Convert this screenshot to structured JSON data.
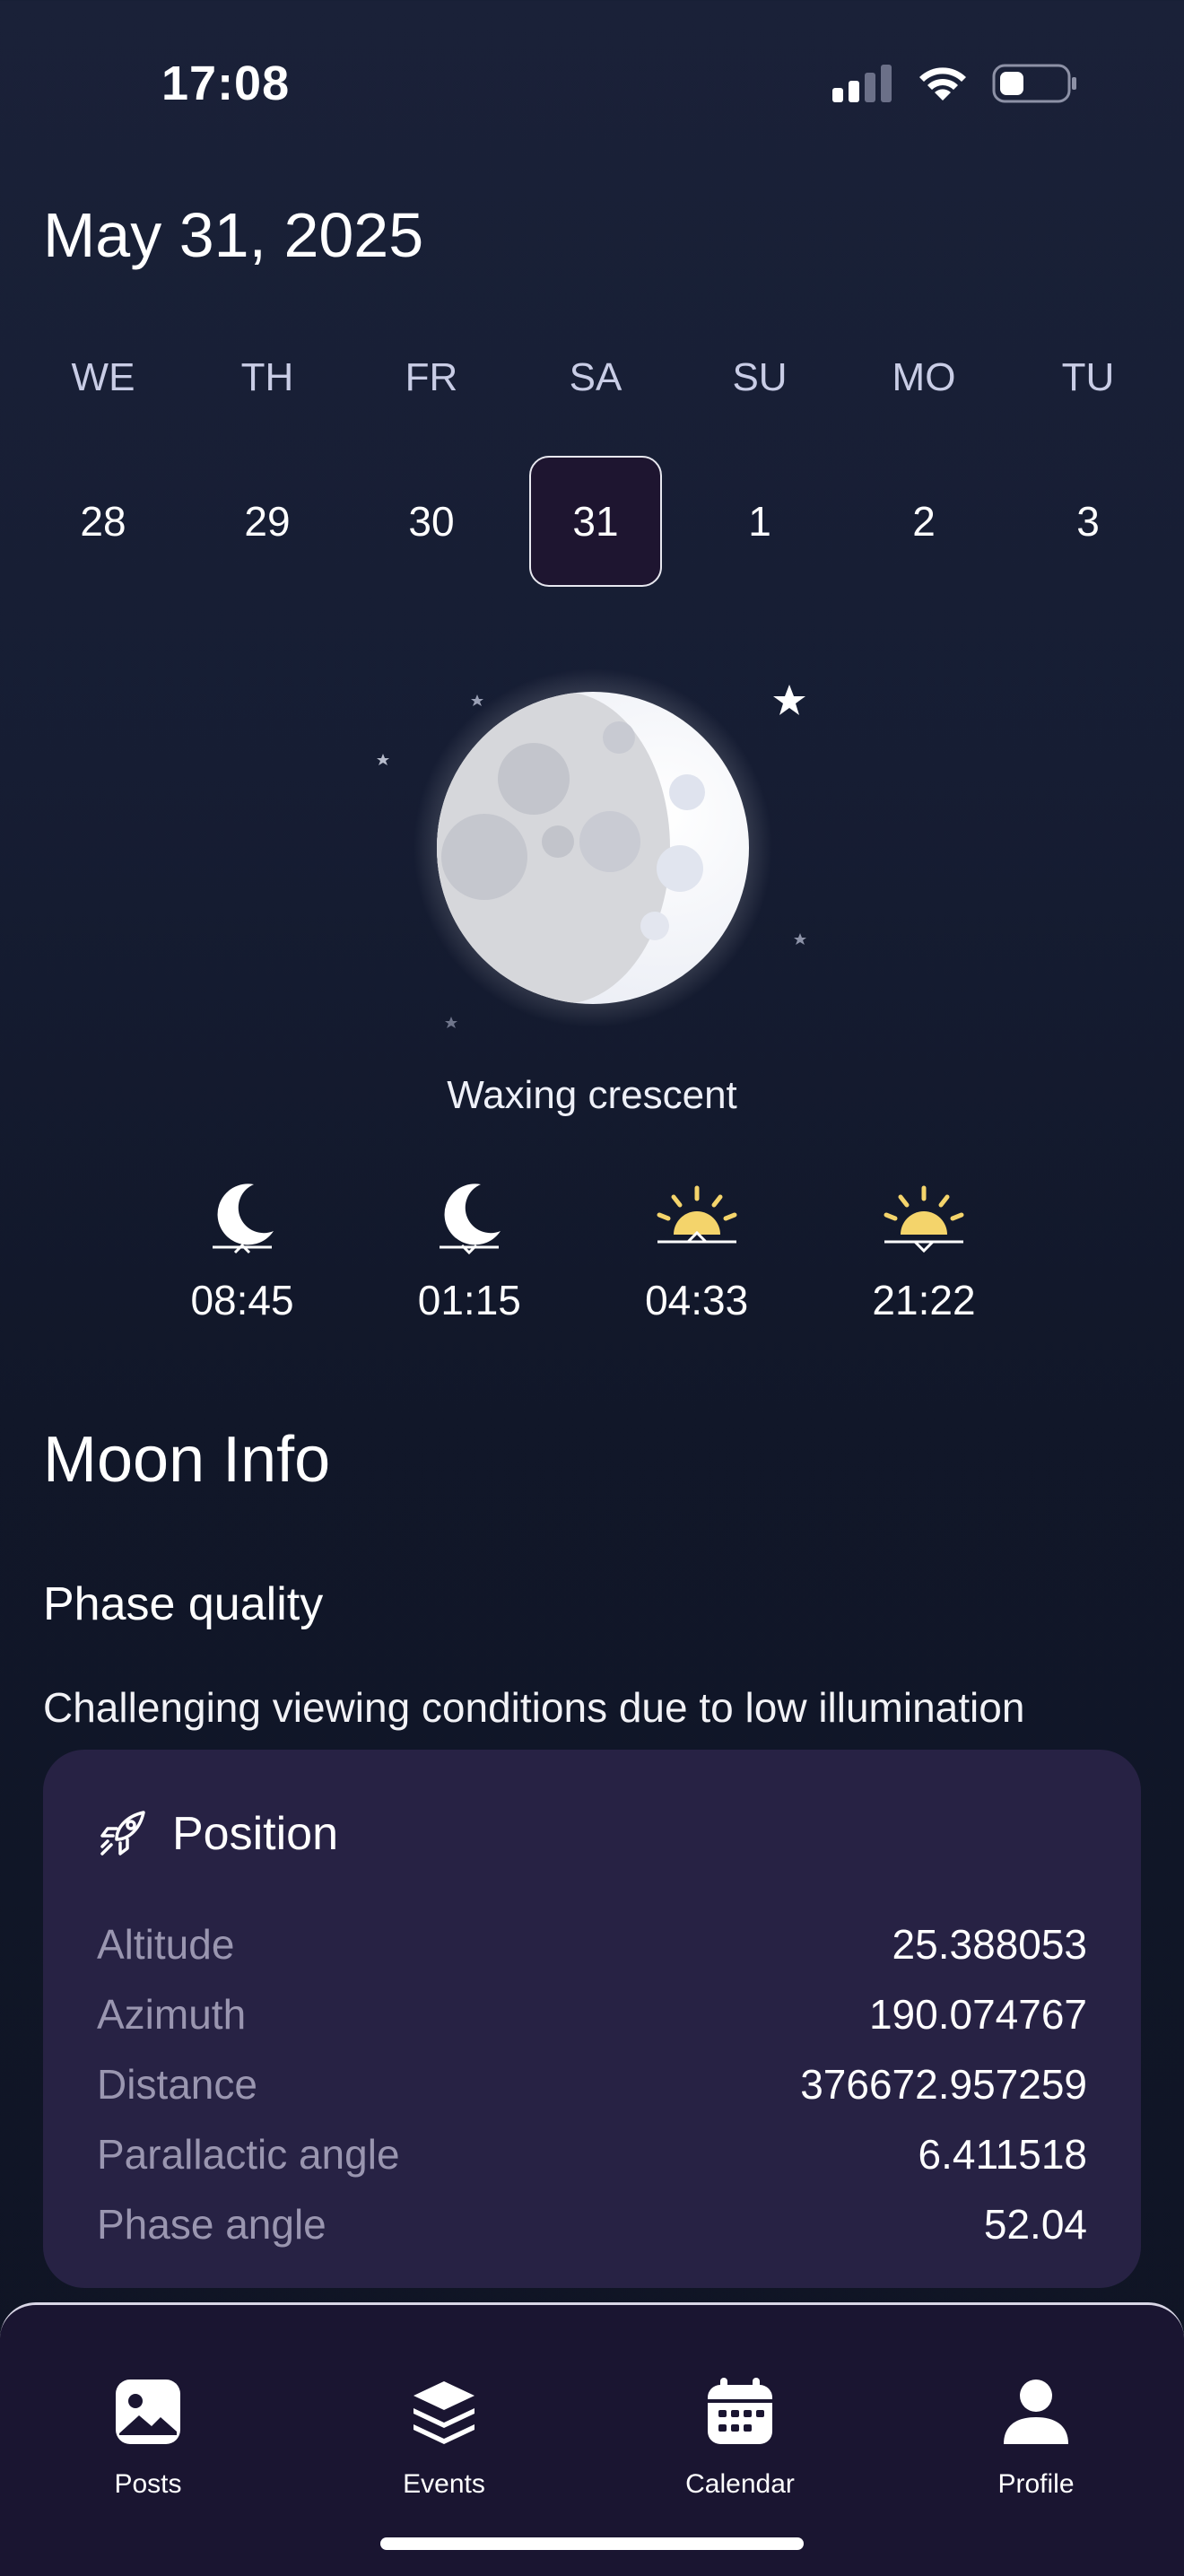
{
  "status_bar": {
    "time": "17:08"
  },
  "header": {
    "date": "May 31, 2025"
  },
  "week": [
    {
      "dow": "WE",
      "day": "28",
      "selected": false
    },
    {
      "dow": "TH",
      "day": "29",
      "selected": false
    },
    {
      "dow": "FR",
      "day": "30",
      "selected": false
    },
    {
      "dow": "SA",
      "day": "31",
      "selected": true
    },
    {
      "dow": "SU",
      "day": "1",
      "selected": false
    },
    {
      "dow": "MO",
      "day": "2",
      "selected": false
    },
    {
      "dow": "TU",
      "day": "3",
      "selected": false
    }
  ],
  "moon": {
    "phase": "Waxing crescent"
  },
  "events": [
    {
      "icon": "moonrise-icon",
      "time": "08:45"
    },
    {
      "icon": "moonset-icon",
      "time": "01:15"
    },
    {
      "icon": "sunrise-icon",
      "time": "04:33"
    },
    {
      "icon": "sunset-icon",
      "time": "21:22"
    }
  ],
  "moon_info": {
    "title": "Moon Info",
    "phase_quality_title": "Phase quality",
    "phase_quality_text": "Challenging viewing conditions due to low illumination"
  },
  "position": {
    "title": "Position",
    "icon": "rocket-icon",
    "rows": [
      {
        "key": "Altitude",
        "value": "25.388053"
      },
      {
        "key": "Azimuth",
        "value": "190.074767"
      },
      {
        "key": "Distance",
        "value": "376672.957259"
      },
      {
        "key": "Parallactic angle",
        "value": "6.411518"
      },
      {
        "key": "Phase angle",
        "value": "52.04"
      }
    ]
  },
  "tabbar": [
    {
      "label": "Posts",
      "icon": "image-icon"
    },
    {
      "label": "Events",
      "icon": "layers-icon"
    },
    {
      "label": "Calendar",
      "icon": "calendar-icon"
    },
    {
      "label": "Profile",
      "icon": "person-icon"
    }
  ],
  "colors": {
    "sun": "#f4d46b",
    "card": "#272244",
    "selected_day": "#1e1530"
  }
}
